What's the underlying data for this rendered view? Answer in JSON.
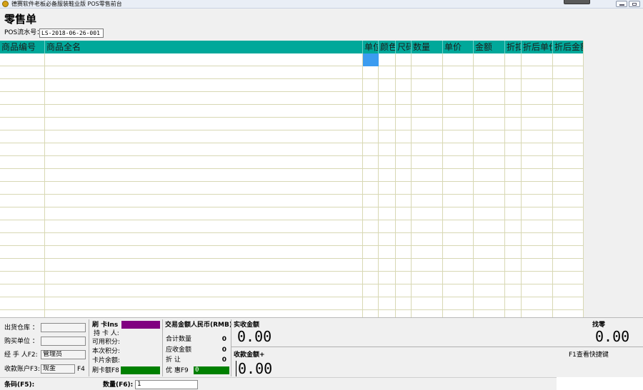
{
  "window": {
    "title": "德赛软件老板必备服装鞋业版  POS零售前台"
  },
  "page": {
    "title": "零售单",
    "pos_label": "POS流水号：",
    "pos_value": "LS-2018-06-26-001"
  },
  "grid": {
    "columns": [
      "商品编号",
      "商品全名",
      "单位",
      "颜色",
      "尺码",
      "数量",
      "单价",
      "金额",
      "折扣",
      "折后单价",
      "折后金额"
    ]
  },
  "left_panel": {
    "warehouse_label": "出货仓库  ：",
    "warehouse_value": "",
    "buyer_label": "购买单位  ：",
    "buyer_value": "",
    "handler_label": "经 手 人F2:",
    "handler_value": "管理员",
    "account_label": "收款账户F3:",
    "account_value": "现金",
    "account_hotkey": "F4"
  },
  "card_panel": {
    "swipe_label": "刷 卡Ins",
    "holder_label": "持 卡 人:",
    "available_points_label": "可用积分:",
    "current_points_label": "本次积分:",
    "card_balance_label": "卡片余额:",
    "card_amount_label": "刷卡额F8",
    "card_amount_value": "",
    "purple": "#800080",
    "green": "#008000"
  },
  "rmb_panel": {
    "title": "交易金额人民币(RMB)",
    "total_qty_label": "合计数量",
    "total_qty_value": "0",
    "receivable_label": "应收金额",
    "receivable_value": "0",
    "discount_label": "折    让",
    "discount_value": "0",
    "promo_label": "优  惠F9",
    "promo_value": "0"
  },
  "payment": {
    "actual_label": "实收金额",
    "actual_value": "0.00",
    "collect_label": "收款金额+",
    "collect_value": "0.00",
    "change_label": "找零",
    "change_value": "0.00",
    "shortcut_hint": "F1查看快捷键"
  },
  "status": {
    "barcode_label": "条码(F5):",
    "barcode_value": "",
    "qty_label": "数量(F6):",
    "qty_value": "1"
  },
  "colors": {
    "grid_header": "#00a89a",
    "selected_cell": "#3b9cf0",
    "grid_line": "#d8d8b4"
  }
}
